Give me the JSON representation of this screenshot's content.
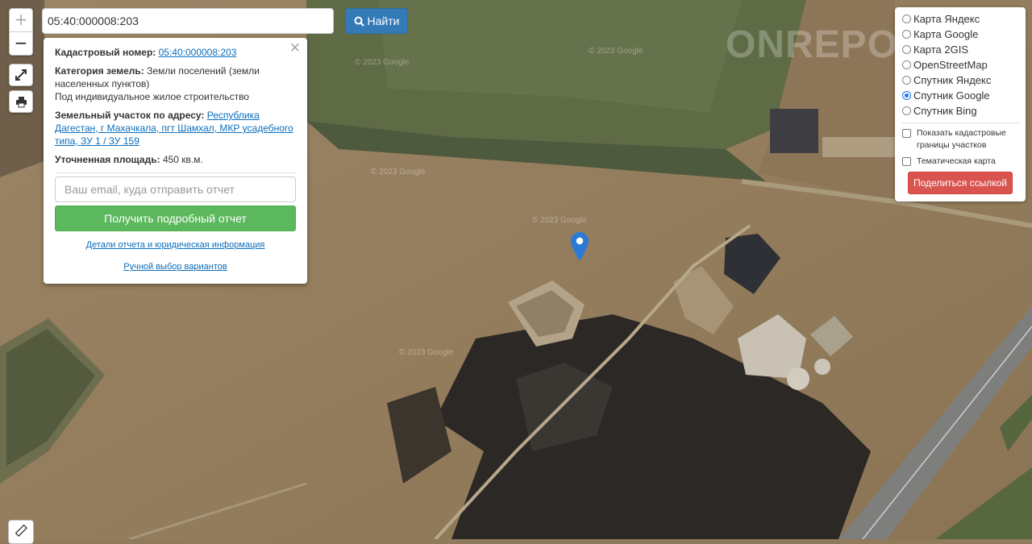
{
  "search": {
    "value": "05:40:000008:203",
    "button_label": "Найти"
  },
  "zoom": {
    "in": "+",
    "out": "−"
  },
  "popup": {
    "cadastral_label": "Кадастровый номер:",
    "cadastral_value": "05:40:000008:203",
    "category_label": "Категория земель:",
    "category_value": "Земли поселений (земли населенных пунктов)",
    "use_value": "Под индивидуальное жилое строительство",
    "address_label": "Земельный участок по адресу:",
    "address_value": "Республика Дагестан, г Махачкала, пгт Шамхал, МКР усадебного типа, ЗУ 1 / ЗУ 159",
    "area_label": "Уточненная площадь:",
    "area_value": "450 кв.м.",
    "email_placeholder": "Ваш email, куда отправить отчет",
    "report_button": "Получить подробный отчет",
    "details_link": "Детали отчета и юридическая информация",
    "manual_link": "Ручной выбор вариантов",
    "close": "×"
  },
  "layers": {
    "options": [
      {
        "label": "Карта Яндекс",
        "selected": false
      },
      {
        "label": "Карта Google",
        "selected": false
      },
      {
        "label": "Карта 2GIS",
        "selected": false
      },
      {
        "label": "OpenStreetMap",
        "selected": false
      },
      {
        "label": "Спутник Яндекс",
        "selected": false
      },
      {
        "label": "Спутник Google",
        "selected": true
      },
      {
        "label": "Спутник Bing",
        "selected": false
      }
    ],
    "checkbox_borders": "Показать кадастровые границы участков",
    "checkbox_thematic": "Тематическая карта",
    "share_button": "Поделиться ссылкой"
  },
  "map": {
    "watermark": "© 2023 Google",
    "logo_watermark": "ONREPORT"
  },
  "colors": {
    "primary": "#337ab7",
    "success": "#5cb85c",
    "danger": "#d9534f",
    "marker": "#2b7bd6"
  }
}
